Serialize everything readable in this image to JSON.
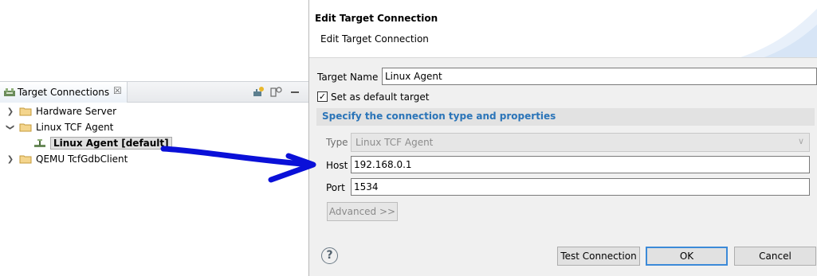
{
  "view": {
    "tab_label": "Target Connections",
    "close_glyph": "☒",
    "icons": {
      "tab": "target-connections-icon",
      "new_connection": "new-connection-icon",
      "filter": "filter-icon",
      "minimize": "minimize-icon"
    }
  },
  "tree": [
    {
      "label": "Hardware Server",
      "expanded": false,
      "icon": "folder-icon"
    },
    {
      "label": "Linux TCF Agent",
      "expanded": true,
      "icon": "folder-icon"
    },
    {
      "label": "Linux Agent [default]",
      "selected": true,
      "icon": "agent-icon"
    },
    {
      "label": "QEMU TcfGdbClient",
      "expanded": false,
      "icon": "folder-icon"
    }
  ],
  "annotation": {
    "color": "#0a10d8"
  },
  "dialog": {
    "title": "Edit Target Connection",
    "subtitle": "Edit Target Connection",
    "target_name_label": "Target Name",
    "target_name_value": "Linux Agent",
    "default_checkbox_label": "Set as default target",
    "default_checked": true,
    "group_title": "Specify the connection type and properties",
    "type_label": "Type",
    "type_value": "Linux TCF Agent",
    "host_label": "Host",
    "host_value": "192.168.0.1",
    "port_label": "Port",
    "port_value": "1534",
    "advanced_label": "Advanced >>",
    "help_label": "?",
    "test_button": "Test Connection",
    "ok_button": "OK",
    "cancel_button": "Cancel"
  },
  "colors": {
    "group_title": "#2a74b8",
    "default_button_border": "#3c8ad8"
  }
}
